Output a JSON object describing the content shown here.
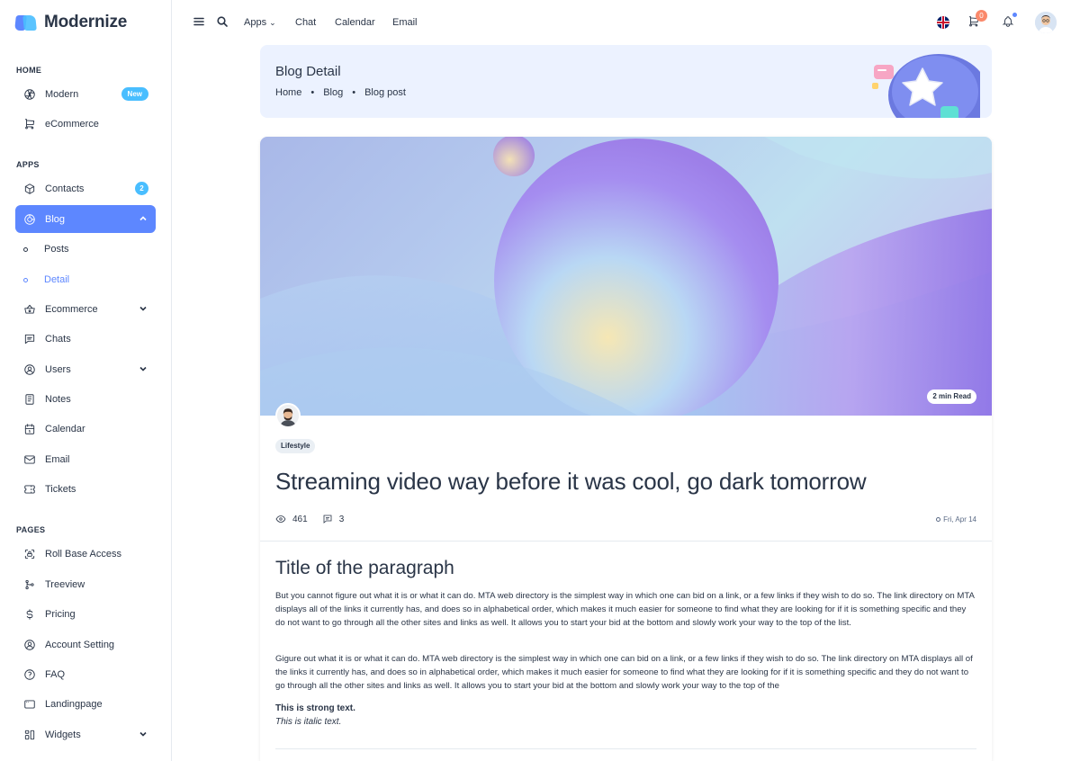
{
  "app": {
    "name": "Modernize"
  },
  "sidebar": {
    "sections": [
      "HOME",
      "APPS",
      "PAGES"
    ],
    "home_items": [
      {
        "label": "Modern",
        "icon": "aperture-icon",
        "badge": "New"
      },
      {
        "label": "eCommerce",
        "icon": "cart-icon"
      }
    ],
    "apps_items": [
      {
        "label": "Contacts",
        "icon": "box-icon",
        "badge": "2"
      },
      {
        "label": "Blog",
        "icon": "chart-donut-icon",
        "expanded": true
      },
      {
        "label": "Ecommerce",
        "icon": "basket-icon"
      },
      {
        "label": "Chats",
        "icon": "message-icon"
      },
      {
        "label": "Users",
        "icon": "user-circle-icon"
      },
      {
        "label": "Notes",
        "icon": "notes-icon"
      },
      {
        "label": "Calendar",
        "icon": "calendar-icon"
      },
      {
        "label": "Email",
        "icon": "mail-icon"
      },
      {
        "label": "Tickets",
        "icon": "ticket-icon"
      }
    ],
    "blog_sub": [
      {
        "label": "Posts"
      },
      {
        "label": "Detail",
        "current": true
      }
    ],
    "pages_items": [
      {
        "label": "Roll Base Access",
        "icon": "lock-access-icon"
      },
      {
        "label": "Treeview",
        "icon": "git-merge-icon"
      },
      {
        "label": "Pricing",
        "icon": "currency-dollar-icon"
      },
      {
        "label": "Account Setting",
        "icon": "user-circle-icon"
      },
      {
        "label": "FAQ",
        "icon": "help-icon"
      },
      {
        "label": "Landingpage",
        "icon": "app-window-icon"
      },
      {
        "label": "Widgets",
        "icon": "layout-icon"
      }
    ]
  },
  "header": {
    "links": [
      "Apps",
      "Chat",
      "Calendar",
      "Email"
    ],
    "cart_count": "0"
  },
  "breadcrumb": {
    "title": "Blog Detail",
    "path": [
      "Home",
      "Blog",
      "Blog post"
    ]
  },
  "post": {
    "read_time": "2 min Read",
    "tag": "Lifestyle",
    "title": "Streaming video way before it was cool, go dark tomorrow",
    "views": "461",
    "comments": "3",
    "date": "Fri, Apr 14",
    "para_title": "Title of the paragraph",
    "para1": "But you cannot figure out what it is or what it can do. MTA web directory is the simplest way in which one can bid on a link, or a few links if they wish to do so. The link directory on MTA displays all of the links it currently has, and does so in alphabetical order, which makes it much easier for someone to find what they are looking for if it is something specific and they do not want to go through all the other sites and links as well. It allows you to start your bid at the bottom and slowly work your way to the top of the list.",
    "para2": "Gigure out what it is or what it can do. MTA web directory is the simplest way in which one can bid on a link, or a few links if they wish to do so. The link directory on MTA displays all of the links it currently has, and does so in alphabetical order, which makes it much easier for someone to find what they are looking for if it is something specific and they do not want to go through all the other sites and links as well. It allows you to start your bid at the bottom and slowly work your way to the top of the",
    "strong_text": "This is strong text.",
    "italic_text": "This is italic text."
  },
  "colors": {
    "primary": "#5d87ff",
    "secondary": "#49beff",
    "warning": "#fa896b",
    "text": "#2a3547",
    "light_primary": "#ecf2ff"
  }
}
